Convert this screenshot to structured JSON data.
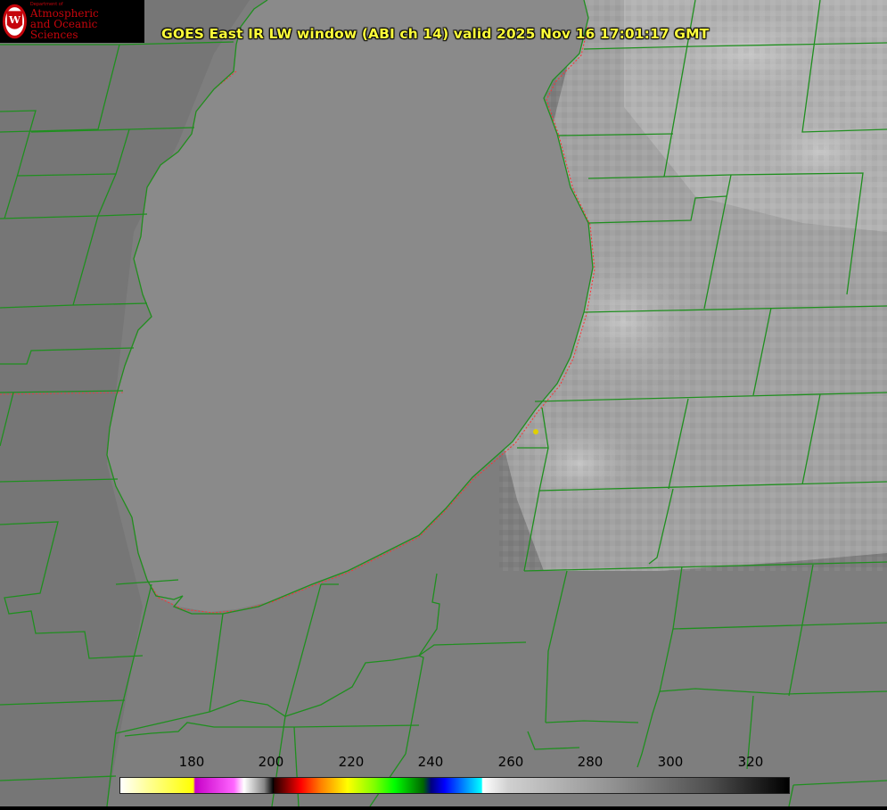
{
  "logo": {
    "dept": "Department of",
    "line1": "Atmospheric",
    "line2": "and Oceanic Sciences",
    "seal_letter": "W"
  },
  "title": "GOES East IR LW window (ABI ch 14) valid 2025 Nov 16 17:01:17 GMT",
  "colorbar": {
    "ticks": [
      "180",
      "200",
      "220",
      "240",
      "260",
      "280",
      "300",
      "320"
    ]
  },
  "colors": {
    "boundary": "#1f8f1f",
    "shoreline_dots": "#ff3030",
    "title": "#ffff3a",
    "marker": "#e0d000",
    "logo": "#c5050c"
  }
}
